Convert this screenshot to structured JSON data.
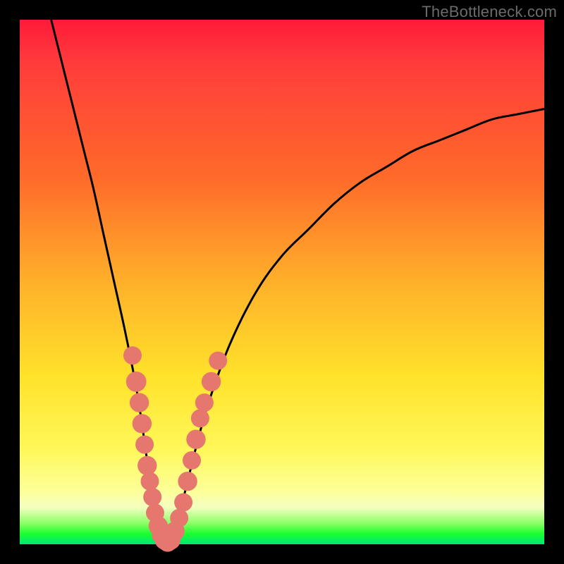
{
  "watermark": "TheBottleneck.com",
  "colors": {
    "frame": "#000000",
    "curve": "#000000",
    "dot_fill": "#e6776f",
    "dot_stroke": "#d85f57"
  },
  "chart_data": {
    "type": "line",
    "title": "",
    "xlabel": "",
    "ylabel": "",
    "xlim": [
      0,
      100
    ],
    "ylim": [
      0,
      100
    ],
    "series": [
      {
        "name": "bottleneck-curve",
        "x": [
          6,
          8,
          10,
          12,
          14,
          16,
          18,
          20,
          22,
          23,
          24,
          25,
          26,
          27,
          28,
          29,
          30,
          32,
          34,
          36,
          40,
          45,
          50,
          55,
          60,
          65,
          70,
          75,
          80,
          85,
          90,
          95,
          100
        ],
        "y": [
          100,
          92,
          84,
          76,
          68,
          59,
          50,
          41,
          31,
          25,
          18,
          11,
          5,
          1,
          0,
          1,
          4,
          12,
          20,
          27,
          38,
          48,
          55,
          60,
          65,
          69,
          72,
          75,
          77,
          79,
          81,
          82,
          83
        ]
      }
    ],
    "dots": [
      {
        "x": 21.5,
        "y": 36,
        "r": 1.2
      },
      {
        "x": 22.2,
        "y": 31,
        "r": 1.4
      },
      {
        "x": 22.8,
        "y": 27,
        "r": 1.3
      },
      {
        "x": 23.3,
        "y": 23,
        "r": 1.3
      },
      {
        "x": 23.8,
        "y": 19,
        "r": 1.2
      },
      {
        "x": 24.3,
        "y": 15,
        "r": 1.3
      },
      {
        "x": 24.8,
        "y": 12,
        "r": 1.2
      },
      {
        "x": 25.3,
        "y": 9,
        "r": 1.2
      },
      {
        "x": 25.8,
        "y": 6,
        "r": 1.2
      },
      {
        "x": 26.4,
        "y": 3.5,
        "r": 1.3
      },
      {
        "x": 27.0,
        "y": 1.8,
        "r": 1.3
      },
      {
        "x": 27.6,
        "y": 0.8,
        "r": 1.3
      },
      {
        "x": 28.2,
        "y": 0.4,
        "r": 1.3
      },
      {
        "x": 28.8,
        "y": 0.8,
        "r": 1.3
      },
      {
        "x": 29.6,
        "y": 2.5,
        "r": 1.3
      },
      {
        "x": 30.4,
        "y": 5,
        "r": 1.2
      },
      {
        "x": 31.2,
        "y": 8,
        "r": 1.2
      },
      {
        "x": 32.0,
        "y": 12,
        "r": 1.3
      },
      {
        "x": 32.8,
        "y": 16,
        "r": 1.2
      },
      {
        "x": 33.6,
        "y": 20,
        "r": 1.3
      },
      {
        "x": 34.4,
        "y": 24,
        "r": 1.2
      },
      {
        "x": 35.2,
        "y": 27,
        "r": 1.2
      },
      {
        "x": 36.5,
        "y": 31,
        "r": 1.3
      },
      {
        "x": 37.8,
        "y": 35,
        "r": 1.2
      }
    ]
  }
}
